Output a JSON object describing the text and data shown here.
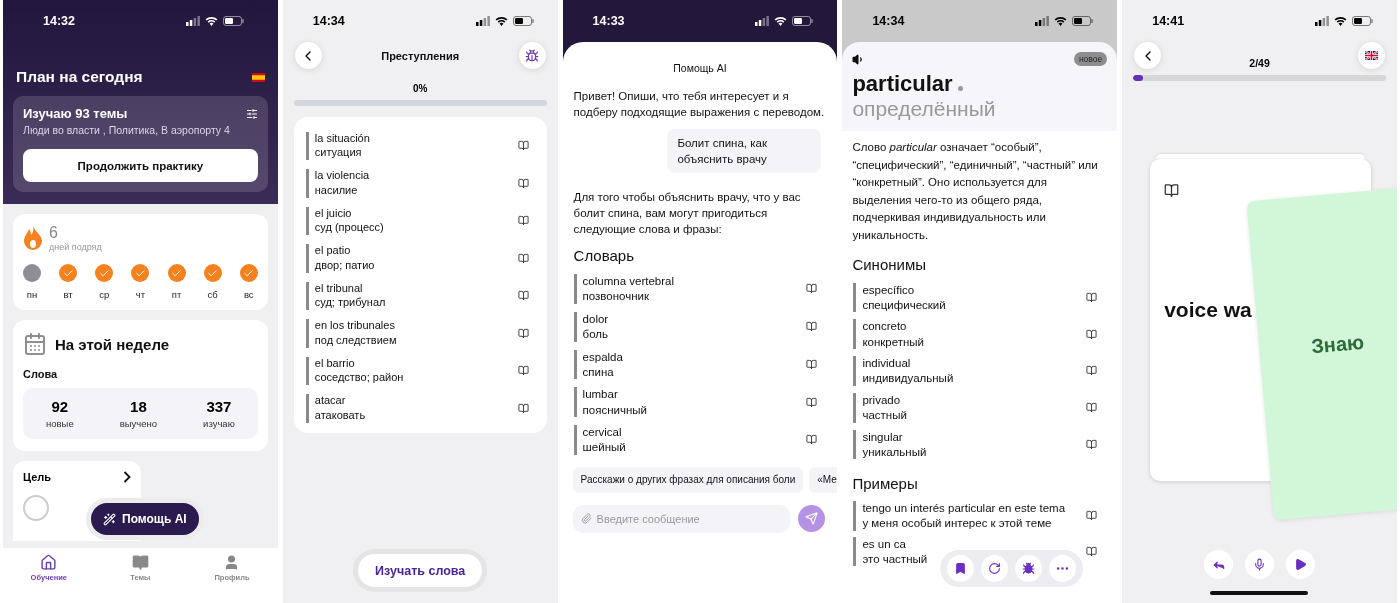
{
  "home_screen": {
    "status_time": "14:32",
    "title": "План на сегодня",
    "plan": {
      "heading": "Изучаю 93 темы",
      "topics": "Люди во власти , Политика, В аэропорту 4",
      "button": "Продолжить практику"
    },
    "streak": {
      "count": "6",
      "label": "дней подряд",
      "days": [
        {
          "label": "пн",
          "done": false
        },
        {
          "label": "вт",
          "done": true
        },
        {
          "label": "ср",
          "done": true
        },
        {
          "label": "чт",
          "done": true
        },
        {
          "label": "пт",
          "done": true
        },
        {
          "label": "сб",
          "done": true
        },
        {
          "label": "вс",
          "done": true
        }
      ]
    },
    "week": {
      "title": "На этой неделе",
      "subtitle": "Слова",
      "stats": [
        {
          "value": "92",
          "label": "новые"
        },
        {
          "value": "18",
          "label": "выучено"
        },
        {
          "value": "337",
          "label": "изучаю"
        }
      ]
    },
    "goal": {
      "title": "Цель"
    },
    "fab": "Помощь AI",
    "tabs": [
      {
        "label": "Обучение",
        "selected": true
      },
      {
        "label": "Темы",
        "selected": false
      },
      {
        "label": "Профиль",
        "selected": false
      }
    ]
  },
  "topic_screen": {
    "status_time": "14:34",
    "title": "Преступления",
    "progress": {
      "reading": "0%",
      "level": 0
    },
    "words": [
      {
        "term": "la situación",
        "translation": "ситуация"
      },
      {
        "term": "la violencia",
        "translation": "насилие"
      },
      {
        "term": "el juicio",
        "translation": "суд (процесс)"
      },
      {
        "term": "el patio",
        "translation": "двор; патио"
      },
      {
        "term": "el tribunal",
        "translation": "суд; трибунал"
      },
      {
        "term": "en los tribunales",
        "translation": "под следствием"
      },
      {
        "term": "el barrio",
        "translation": "соседство; район"
      },
      {
        "term": "atacar",
        "translation": "атаковать"
      }
    ],
    "button": "Изучать слова"
  },
  "chat_screen": {
    "status_time": "14:33",
    "title": "Помощь AI",
    "messages": [
      {
        "kind": "bot",
        "text": "Привет! Опиши, что тебя интересует и я подберу подходящие выражения с переводом."
      },
      {
        "kind": "user",
        "text": "Болит спина, как объяснить врачу"
      },
      {
        "kind": "bot",
        "text": "Для того чтобы объяснить врачу, что у вас болит спина, вам могут пригодиться следующие слова и фразы:"
      }
    ],
    "section_title": "Словарь",
    "vocabulary": [
      {
        "term": "columna vertebral",
        "translation": "позвоночник"
      },
      {
        "term": "dolor",
        "translation": "боль"
      },
      {
        "term": "espalda",
        "translation": "спина"
      },
      {
        "term": "lumbar",
        "translation": "поясничный"
      },
      {
        "term": "cervical",
        "translation": "шейный"
      }
    ],
    "suggestions": [
      "Расскажи о других фразах для описания боли",
      "«Ме"
    ],
    "input": {
      "placeholder": "Введите сообщение"
    }
  },
  "word_screen": {
    "status_time": "14:34",
    "badge": "новое",
    "word": "particular",
    "translation": "определённый",
    "description": "Слово *particular* означает “особый”, “специфический”, “единичный”, “частный” или “конкретный”. Оно используется для выделения чего-то из общего ряда, подчеркивая индивидуальность или уникальность.",
    "synonyms_title": "Синонимы",
    "synonyms": [
      {
        "term": "específico",
        "translation": "специфический"
      },
      {
        "term": "concreto",
        "translation": "конкретный"
      },
      {
        "term": "individual",
        "translation": "индивидуальный"
      },
      {
        "term": "privado",
        "translation": "частный"
      },
      {
        "term": "singular",
        "translation": "уникальный"
      }
    ],
    "examples_title": "Примеры",
    "examples": [
      {
        "term": "tengo un interés particular en este tema",
        "translation": "у меня особый интерес к этой теме"
      },
      {
        "term": "es un ca",
        "translation": "это частный"
      }
    ]
  },
  "flashcard_screen": {
    "status_time": "14:41",
    "counter": "2/49",
    "progress": {
      "level": 0.04
    },
    "card_word": "voice wa",
    "swipe_label": "Знаю"
  }
}
